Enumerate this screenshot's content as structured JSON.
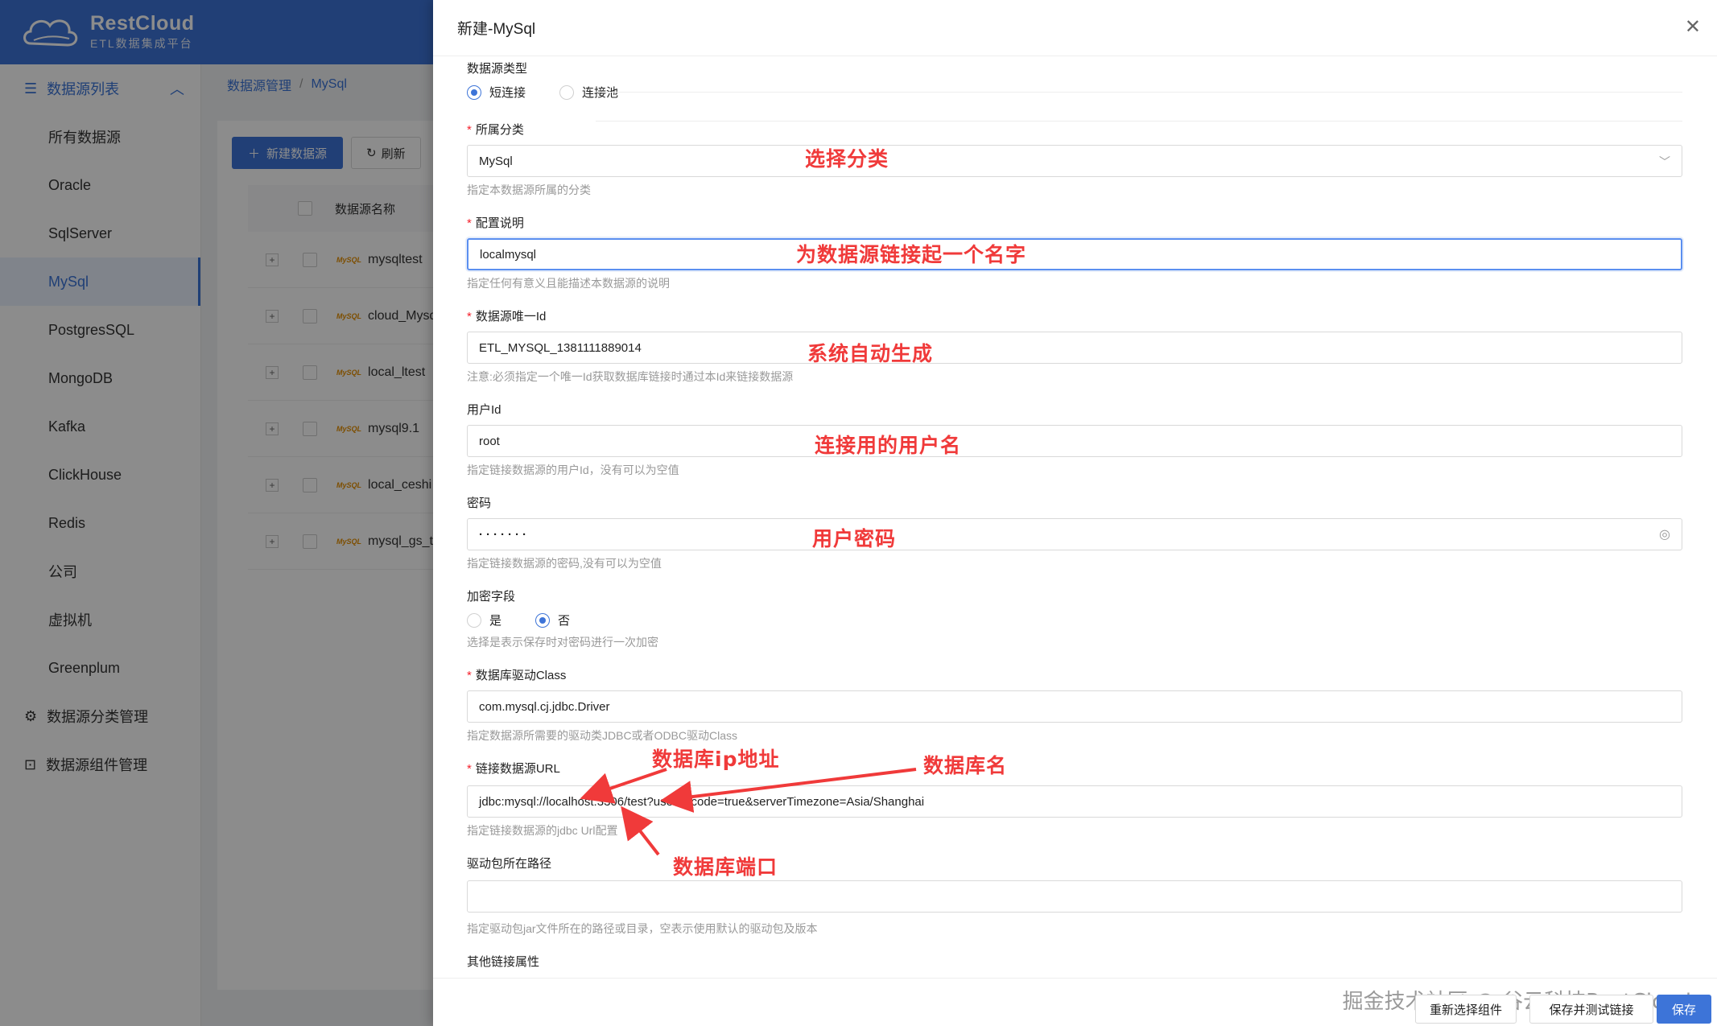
{
  "brand": {
    "name": "RestCloud",
    "subtitle": "ETL数据集成平台"
  },
  "sidebar": {
    "header": "数据源列表",
    "items": [
      {
        "label": "所有数据源"
      },
      {
        "label": "Oracle"
      },
      {
        "label": "SqlServer"
      },
      {
        "label": "MySql"
      },
      {
        "label": "PostgresSQL"
      },
      {
        "label": "MongoDB"
      },
      {
        "label": "Kafka"
      },
      {
        "label": "ClickHouse"
      },
      {
        "label": "Redis"
      },
      {
        "label": "公司"
      },
      {
        "label": "虚拟机"
      },
      {
        "label": "Greenplum"
      }
    ],
    "active_index": 3,
    "groups": [
      {
        "label": "数据源分类管理",
        "icon": "gear-icon"
      },
      {
        "label": "数据源组件管理",
        "icon": "component-icon"
      }
    ]
  },
  "breadcrumb": {
    "root": "数据源管理",
    "current": "MySql"
  },
  "toolbar": {
    "new_label": "新建数据源",
    "refresh_label": "刷新"
  },
  "table": {
    "header_name": "数据源名称",
    "rows": [
      {
        "name": "mysqltest"
      },
      {
        "name": "cloud_Mysq"
      },
      {
        "name": "local_ltest"
      },
      {
        "name": "mysql9.1"
      },
      {
        "name": "local_ceshi"
      },
      {
        "name": "mysql_gs_t"
      }
    ],
    "logo_text": "MySQL"
  },
  "drawer": {
    "title": "新建-MySql",
    "source_type": {
      "label": "数据源类型",
      "options": [
        "短连接",
        "连接池"
      ],
      "selected": "短连接"
    },
    "category": {
      "label": "所属分类",
      "value": "MySql",
      "help": "指定本数据源所属的分类"
    },
    "description": {
      "label": "配置说明",
      "value": "localmysql",
      "help": "指定任何有意义且能描述本数据源的说明"
    },
    "unique_id": {
      "label": "数据源唯一Id",
      "value": "ETL_MYSQL_1381111889014",
      "help": "注意:必须指定一个唯一Id获取数据库链接时通过本Id来链接数据源"
    },
    "user_id": {
      "label": "用户Id",
      "value": "root",
      "help": "指定链接数据源的用户Id，没有可以为空值"
    },
    "password": {
      "label": "密码",
      "value": "·······",
      "help": "指定链接数据源的密码,没有可以为空值"
    },
    "encrypt": {
      "label": "加密字段",
      "options": [
        "是",
        "否"
      ],
      "selected": "否",
      "help": "选择是表示保存时对密码进行一次加密"
    },
    "driver_class": {
      "label": "数据库驱动Class",
      "value": "com.mysql.cj.jdbc.Driver",
      "help": "指定数据源所需要的驱动类JDBC或者ODBC驱动Class"
    },
    "url": {
      "label": "链接数据源URL",
      "value": "jdbc:mysql://localhost:3306/test?useUnicode=true&serverTimezone=Asia/Shanghai",
      "help": "指定链接数据源的jdbc Url配置"
    },
    "driver_path": {
      "label": "驱动包所在路径",
      "value": "",
      "help": "指定驱动包jar文件所在的路径或目录，空表示使用默认的驱动包及版本"
    },
    "other_props": {
      "label": "其他链接属性"
    }
  },
  "annotations": {
    "category": "选择分类",
    "description": "为数据源链接起一个名字",
    "unique_id": "系统自动生成",
    "user_id": "连接用的用户名",
    "password": "用户密码",
    "db_ip": "数据库ip地址",
    "db_name": "数据库名",
    "db_port": "数据库端口",
    "color": "#f03a3a"
  },
  "footer": {
    "reselect_label": "重新选择组件",
    "save_test_label": "保存并测试链接",
    "save_label": "保存",
    "watermark": "掘金技术社区 @ 谷云科技RestCloud"
  },
  "colors": {
    "primary": "#3d74d8",
    "required": "#f5222d",
    "annotation": "#f03a3a"
  }
}
